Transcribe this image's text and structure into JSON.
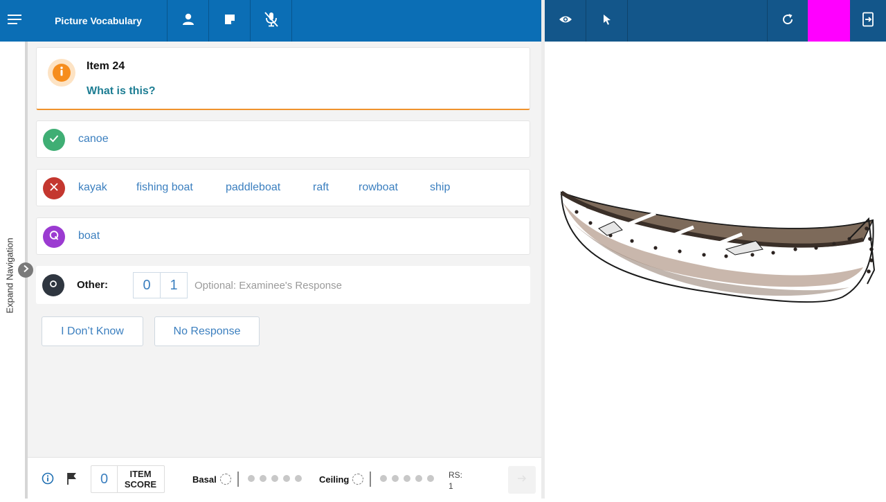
{
  "app": {
    "title": "Picture Vocabulary"
  },
  "colors": {
    "primary": "#0b6eb5",
    "secondary_bar": "#13568a",
    "correct": "#3fae74",
    "incorrect": "#c4372f",
    "query": "#9b3bd1",
    "other": "#2f3640",
    "accent": "#f68d1d",
    "link": "#3b7fbf",
    "prompt": "#1d7d93",
    "highlight": "#ff00ff"
  },
  "toolbar": {
    "left_icons": [
      "menu-icon",
      "person-icon",
      "note-icon",
      "mic-off-icon"
    ],
    "right_icons": [
      "eye-icon",
      "pointer-icon",
      "refresh-icon",
      "exit-icon"
    ]
  },
  "navigation": {
    "label": "Expand Navigation"
  },
  "item": {
    "label": "Item 24",
    "prompt": "What is this?"
  },
  "responses": {
    "correct": [
      "canoe"
    ],
    "incorrect": [
      "kayak",
      "fishing boat",
      "paddleboat",
      "raft",
      "rowboat",
      "ship"
    ],
    "query": [
      "boat"
    ]
  },
  "other": {
    "label": "Other:",
    "score_0": "0",
    "score_1": "1",
    "placeholder": "Optional: Examinee's Response"
  },
  "buttons": {
    "dont_know": "I Don’t Know",
    "no_response": "No Response"
  },
  "footer": {
    "item_score_value": "0",
    "item_score_label_1": "ITEM",
    "item_score_label_2": "SCORE",
    "basal_label": "Basal",
    "ceiling_label": "Ceiling",
    "rs_label": "RS:",
    "rs_value": "1"
  },
  "stimulus": {
    "image": "canoe-illustration"
  }
}
